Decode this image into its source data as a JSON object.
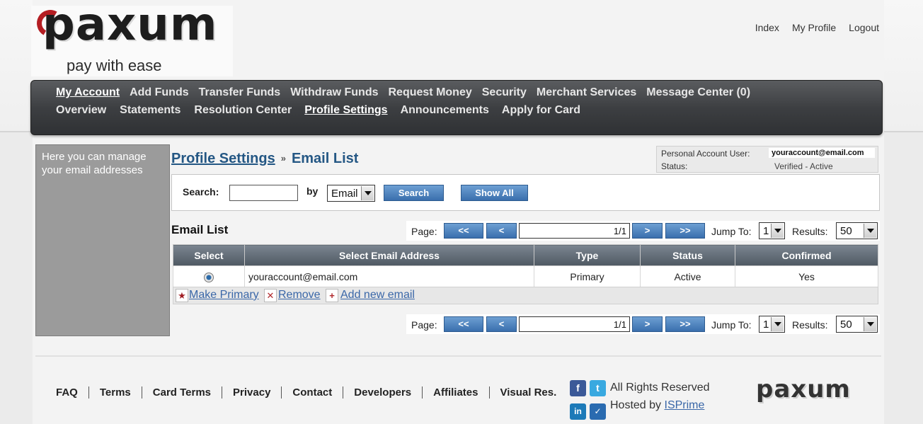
{
  "logo": {
    "word": "paxum",
    "tagline": "pay with ease"
  },
  "top_links": [
    "Index",
    "My Profile",
    "Logout"
  ],
  "nav": {
    "row1": [
      "My Account",
      "Add Funds",
      "Transfer Funds",
      "Withdraw Funds",
      "Request Money",
      "Security",
      "Merchant Services",
      "Message Center (0)"
    ],
    "row2": [
      "Overview",
      "Statements",
      "Resolution Center",
      "Profile Settings",
      "Announcements",
      "Apply for Card"
    ]
  },
  "sidebar": {
    "text": "Here you can manage your email addresses"
  },
  "breadcrumb": {
    "parent": "Profile Settings",
    "separator": "»",
    "current": "Email List"
  },
  "account": {
    "user_label": "Personal Account User:",
    "user_value": "youraccount@email.com",
    "status_label": "Status:",
    "status_value": "Verified - Active"
  },
  "search": {
    "label": "Search:",
    "value": "",
    "by_label": "by",
    "by_selected": "Email",
    "search_button": "Search",
    "show_all_button": "Show All"
  },
  "list": {
    "title": "Email List",
    "pager": {
      "page_label": "Page:",
      "first": "<<",
      "prev": "<",
      "page_value": "1/1",
      "next": ">",
      "last": ">>",
      "jump_label": "Jump To:",
      "jump_value": "1",
      "results_label": "Results:",
      "results_value": "50"
    },
    "columns": [
      "Select",
      "Select Email Address",
      "Type",
      "Status",
      "Confirmed"
    ],
    "rows": [
      {
        "email": "youraccount@email.com",
        "type": "Primary",
        "status": "Active",
        "confirmed": "Yes"
      }
    ],
    "actions": {
      "make_primary": "Make Primary",
      "remove": "Remove",
      "add_new": "Add new email"
    }
  },
  "footer": {
    "links": [
      "FAQ",
      "Terms",
      "Card Terms",
      "Privacy",
      "Contact",
      "Developers",
      "Affiliates",
      "Visual Res."
    ],
    "rights": "All Rights Reserved",
    "hosted_by": "Hosted by",
    "host_link": "ISPrime",
    "logo_word": "paxum"
  },
  "colors": {
    "link_blue": "#3a67a8",
    "nav_dark": "#3d3f42",
    "button_blue": "#3a6fad",
    "header_blue": "#245784"
  }
}
